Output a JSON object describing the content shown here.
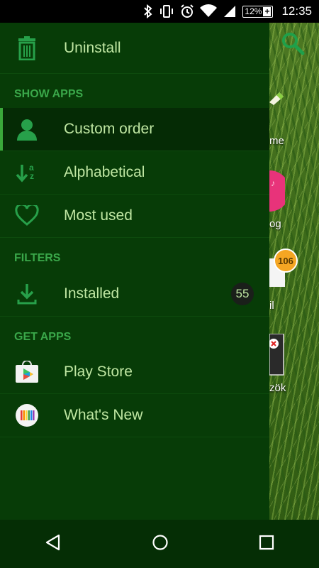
{
  "status": {
    "battery": "12%",
    "battery_plus": "+",
    "time": "12:35"
  },
  "drawer": {
    "top_item": {
      "label": "Uninstall",
      "icon": "trash-icon"
    },
    "sections": [
      {
        "header": "SHOW APPS",
        "items": [
          {
            "label": "Custom order",
            "icon": "person-icon",
            "active": true
          },
          {
            "label": "Alphabetical",
            "icon": "sort-az-icon"
          },
          {
            "label": "Most used",
            "icon": "heart-icon"
          }
        ]
      },
      {
        "header": "FILTERS",
        "items": [
          {
            "label": "Installed",
            "icon": "download-icon",
            "badge": "55"
          }
        ]
      },
      {
        "header": "GET APPS",
        "items": [
          {
            "label": "Play Store",
            "icon": "play-store-icon"
          },
          {
            "label": "What's New",
            "icon": "whats-new-icon"
          }
        ]
      }
    ]
  },
  "background_peek": {
    "labels": [
      "me",
      "og",
      "il",
      "zök"
    ],
    "notification_badge": "106"
  },
  "colors": {
    "drawer_bg": "#073c07",
    "accent": "#3aa84a",
    "text": "#bfe6a2"
  }
}
